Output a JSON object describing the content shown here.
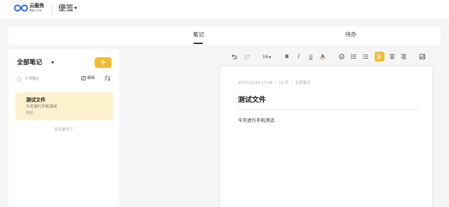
{
  "header": {
    "logo_title": "云服务",
    "logo_subtitle": "随身工作台",
    "app_title": "便签"
  },
  "tabs": [
    {
      "label": "笔记",
      "active": true
    },
    {
      "label": "待办",
      "active": false
    }
  ],
  "sidebar": {
    "heading": "全部笔记",
    "add_label": "+",
    "count_text": "1 项笔记",
    "edit_label": "编辑",
    "notes": [
      {
        "title": "测试文件",
        "snippet": "今天进行手机测试",
        "time": "刚刚"
      }
    ],
    "no_more_text": "没有更多了"
  },
  "toolbar": {
    "font_size": "16",
    "buttons": [
      "undo-icon",
      "redo-icon",
      "font-size",
      "bold-icon",
      "italic-icon",
      "underline-icon",
      "highlight-icon",
      "checklist-icon",
      "bullet-list-icon",
      "numbered-list-icon",
      "align-left-icon",
      "align-center-icon",
      "align-right-icon",
      "image-icon"
    ],
    "active": "align-left-icon"
  },
  "editor": {
    "meta": "2023/11/10 17:04 ｜ 12 字 ｜ 全部笔记",
    "title": "测试文件",
    "body": "今天进行手机测试"
  },
  "colors": {
    "accent": "#f5b82e",
    "card_bg": "#fdf1cd",
    "page_bg": "#f5f5f5",
    "logo_blue": "#2f6bd8"
  }
}
